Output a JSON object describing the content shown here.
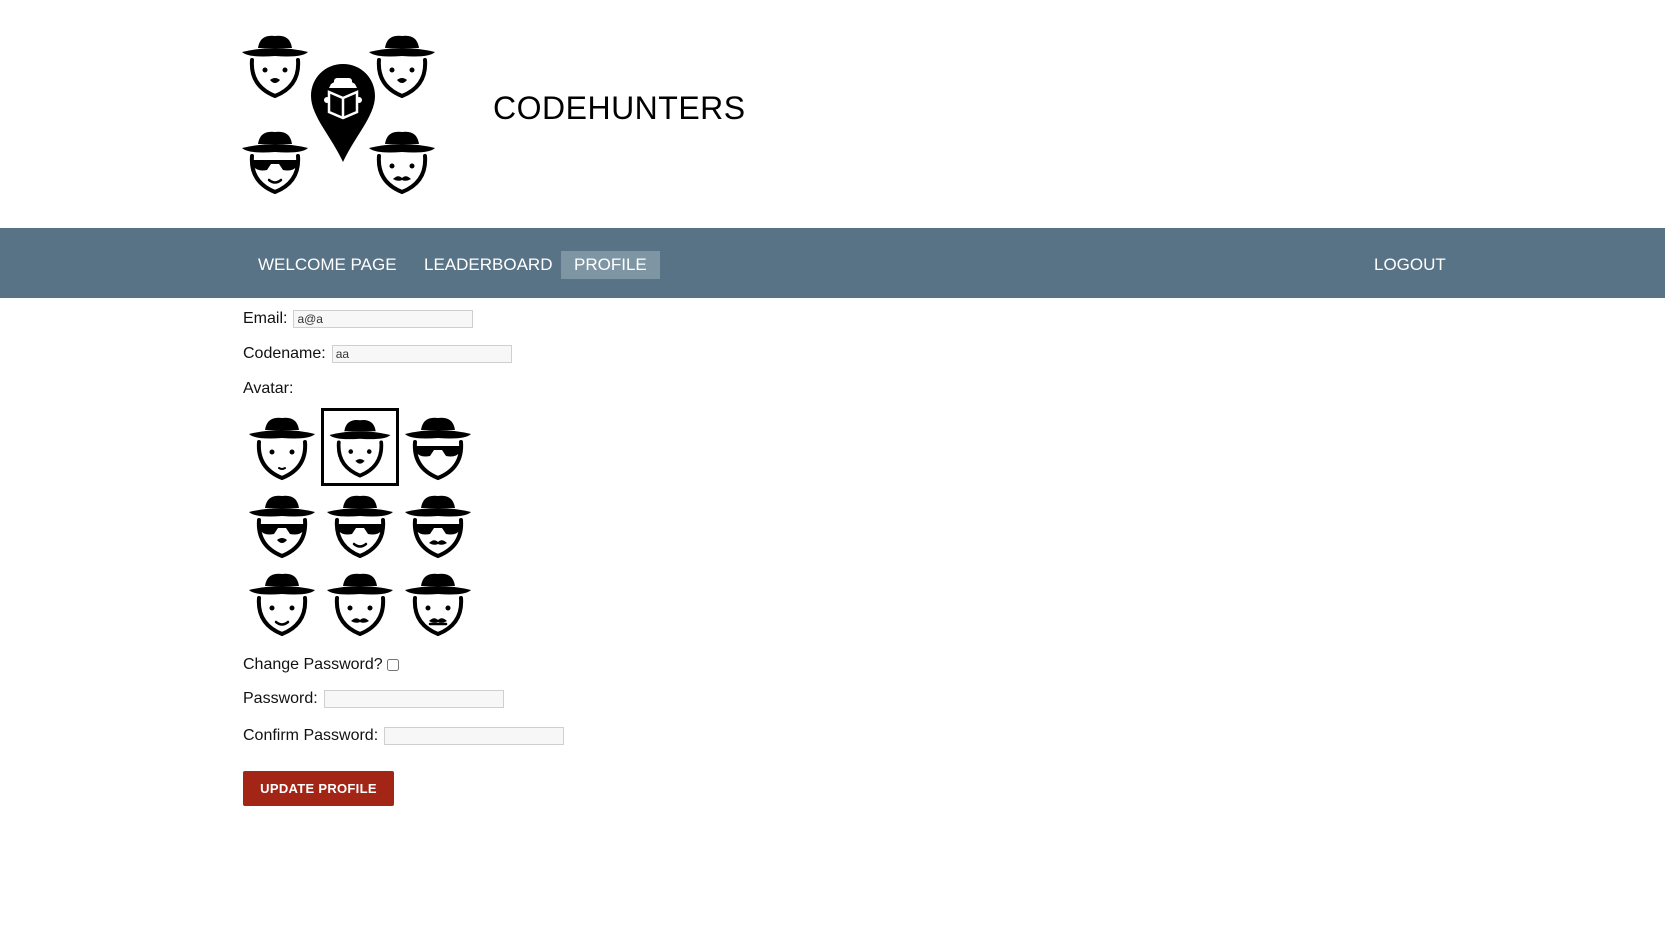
{
  "header": {
    "site_title": "CODEHUNTERS",
    "logo_icon": "detective-map-pin-logo-icon"
  },
  "nav": {
    "items": [
      {
        "label": "WELCOME PAGE",
        "active": false
      },
      {
        "label": "LEADERBOARD",
        "active": false
      },
      {
        "label": "PROFILE",
        "active": true
      }
    ],
    "logout_label": "LOGOUT",
    "bar_color": "#587385",
    "active_color": "#7e95a4"
  },
  "form": {
    "email_label": "Email:",
    "email_value": "a@a",
    "codename_label": "Codename:",
    "codename_value": "aa",
    "avatar_label": "Avatar:",
    "avatars": [
      {
        "icon": "detective-plain-icon",
        "selected": false
      },
      {
        "icon": "detective-nose-icon",
        "selected": true
      },
      {
        "icon": "detective-sunglasses-icon",
        "selected": false
      },
      {
        "icon": "detective-sunglasses-nose-icon",
        "selected": false
      },
      {
        "icon": "detective-sunglasses-smile-icon",
        "selected": false
      },
      {
        "icon": "detective-sunglasses-mustache-icon",
        "selected": false
      },
      {
        "icon": "detective-smile-icon",
        "selected": false
      },
      {
        "icon": "detective-mustache-icon",
        "selected": false
      },
      {
        "icon": "detective-frown-mustache-icon",
        "selected": false
      }
    ],
    "change_password_label": "Change Password?",
    "change_password_checked": false,
    "password_label": "Password:",
    "password_value": "",
    "confirm_password_label": "Confirm Password:",
    "confirm_password_value": "",
    "update_button_label": "UPDATE PROFILE",
    "update_button_color": "#a32516"
  }
}
